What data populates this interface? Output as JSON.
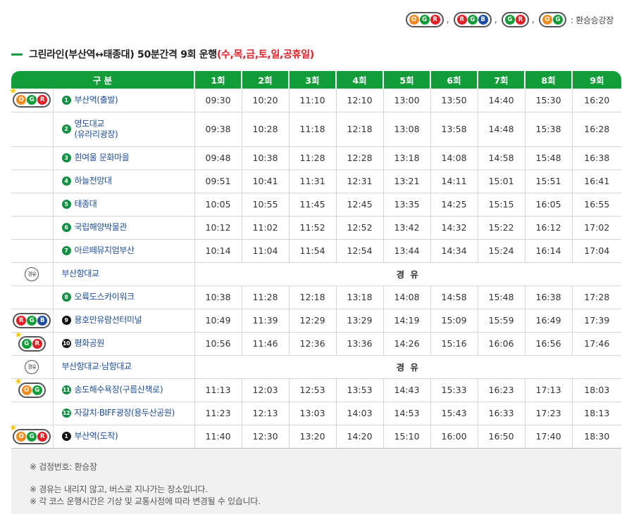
{
  "legend": {
    "badges": [
      [
        "O",
        "G",
        "R"
      ],
      [
        "R",
        "G",
        "B"
      ],
      [
        "G",
        "R"
      ],
      [
        "O",
        "G"
      ]
    ],
    "separator": ",",
    "label": ": 환승승강장"
  },
  "colors": {
    "O": "#f28c1e",
    "G": "#139c3a",
    "R": "#e21e26",
    "B": "#1d4ea3",
    "header": "#139c3a",
    "accent": "#e21e26",
    "stop_text": "#1e4e96"
  },
  "title": {
    "main": "그린라인(부산역↔태종대) 50분간격 9회 운행",
    "days": "(수,목,금,토,일,공휴일)"
  },
  "table": {
    "headers": [
      "구 분",
      "1회",
      "2회",
      "3회",
      "4회",
      "5회",
      "6회",
      "7회",
      "8회",
      "9회"
    ],
    "rows": [
      {
        "icon": [
          "O",
          "G",
          "R"
        ],
        "star": true,
        "num": "1",
        "num_style": "green",
        "stop": "부산역(출발)",
        "times": [
          "09:30",
          "10:20",
          "11:10",
          "12:10",
          "13:00",
          "13:50",
          "14:40",
          "15:30",
          "16:20"
        ]
      },
      {
        "icon": null,
        "num": "2",
        "num_style": "green",
        "stop": "영도대교",
        "stop2": "(유라리광장)",
        "times": [
          "09:38",
          "10:28",
          "11:18",
          "12:18",
          "13:08",
          "13:58",
          "14:48",
          "15:38",
          "16:28"
        ]
      },
      {
        "icon": null,
        "num": "3",
        "num_style": "green",
        "stop": "흰여울 문화마을",
        "times": [
          "09:48",
          "10:38",
          "11:28",
          "12:28",
          "13:18",
          "14:08",
          "14:58",
          "15:48",
          "16:38"
        ]
      },
      {
        "icon": null,
        "num": "4",
        "num_style": "green",
        "stop": "하늘전망대",
        "times": [
          "09:51",
          "10:41",
          "11:31",
          "12:31",
          "13:21",
          "14:11",
          "15:01",
          "15:51",
          "16:41"
        ]
      },
      {
        "icon": null,
        "num": "5",
        "num_style": "green",
        "stop": "태종대",
        "times": [
          "10:05",
          "10:55",
          "11:45",
          "12:45",
          "13:35",
          "14:25",
          "15:15",
          "16:05",
          "16:55"
        ]
      },
      {
        "icon": null,
        "num": "6",
        "num_style": "green",
        "stop": "국립해양박물관",
        "times": [
          "10:12",
          "11:02",
          "11:52",
          "12:52",
          "13:42",
          "14:32",
          "15:22",
          "16:12",
          "17:02"
        ]
      },
      {
        "icon": null,
        "num": "7",
        "num_style": "green",
        "stop": "아르떼뮤지엄부산",
        "times": [
          "10:14",
          "11:04",
          "11:54",
          "12:54",
          "13:44",
          "14:34",
          "15:24",
          "16:14",
          "17:04"
        ]
      },
      {
        "pass": true,
        "pass_icon": "경유",
        "stop": "부산항대교",
        "pass_text": "경 유"
      },
      {
        "icon": null,
        "num": "8",
        "num_style": "green",
        "stop": "오륙도스카이워크",
        "times": [
          "10:38",
          "11:28",
          "12:18",
          "13:18",
          "14:08",
          "14:58",
          "15:48",
          "16:38",
          "17:28"
        ]
      },
      {
        "icon": [
          "R",
          "G",
          "B"
        ],
        "star": false,
        "num": "9",
        "num_style": "black",
        "stop": "용호만유람선터미널",
        "times": [
          "10:49",
          "11:39",
          "12:29",
          "13:29",
          "14:19",
          "15:09",
          "15:59",
          "16:49",
          "17:39"
        ]
      },
      {
        "icon": [
          "G",
          "R"
        ],
        "star": true,
        "num": "10",
        "num_style": "black",
        "stop": "평화공원",
        "times": [
          "10:56",
          "11:46",
          "12:36",
          "13:36",
          "14:26",
          "15:16",
          "16:06",
          "16:56",
          "17:46"
        ]
      },
      {
        "pass": true,
        "pass_icon": "경유",
        "stop": "부산항대교·남항대교",
        "pass_text": "경 유"
      },
      {
        "icon": [
          "O",
          "G"
        ],
        "star": true,
        "num": "11",
        "num_style": "green",
        "stop": "송도해수욕장(구름산책로)",
        "times": [
          "11:13",
          "12:03",
          "12:53",
          "13:53",
          "14:43",
          "15:33",
          "16:23",
          "17:13",
          "18:03"
        ]
      },
      {
        "icon": null,
        "num": "12",
        "num_style": "green",
        "stop": "자갈치·BIFF광장(용두산공원)",
        "times": [
          "11:23",
          "12:13",
          "13:03",
          "14:03",
          "14:53",
          "15:43",
          "16:33",
          "17:23",
          "18:13"
        ]
      },
      {
        "icon": [
          "O",
          "G",
          "R"
        ],
        "star": true,
        "num": "1",
        "num_style": "black",
        "stop": "부산역(도착)",
        "times": [
          "11:40",
          "12:30",
          "13:20",
          "14:20",
          "15:10",
          "16:00",
          "16:50",
          "17:40",
          "18:30"
        ]
      }
    ]
  },
  "notes": {
    "n1": "※ 검정번호: 환승장",
    "n2": "※ 경유는 내리지 않고, 버스로 지나가는 장소입니다.",
    "n3": "※ 각 코스 운행시간은 기상 및 교통사정에 따라 변경될 수 있습니다."
  }
}
